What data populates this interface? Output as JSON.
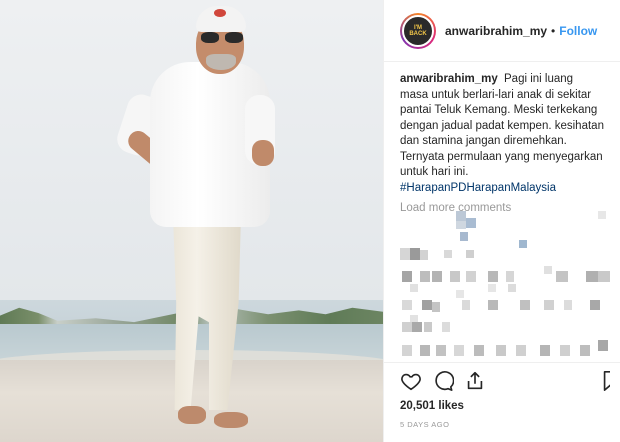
{
  "post": {
    "username": "anwaribrahim_my",
    "separator": "•",
    "follow_label": "Follow",
    "avatar_text": "I'M BACK",
    "caption_user": "anwaribrahim_my",
    "caption_text": "Pagi ini luang masa untuk berlari-lari anak di sekitar pantai Teluk Kemang. Meski terkekang dengan jadual padat kempen. kesihatan dan stamina jangan diremehkan. Ternyata permulaan yang menyegarkan untuk hari ini.",
    "hashtags": "#HarapanPDHarapanMalaysia",
    "load_more": "Load more comments",
    "likes": "20,501 likes",
    "date": "5 DAYS AGO"
  },
  "icons": {
    "like": "heart-icon",
    "comment": "comment-icon",
    "share": "share-icon",
    "save": "bookmark-icon"
  },
  "colors": {
    "link": "#3897f0",
    "hashtag": "#003569",
    "muted": "#999999",
    "text": "#262626"
  }
}
